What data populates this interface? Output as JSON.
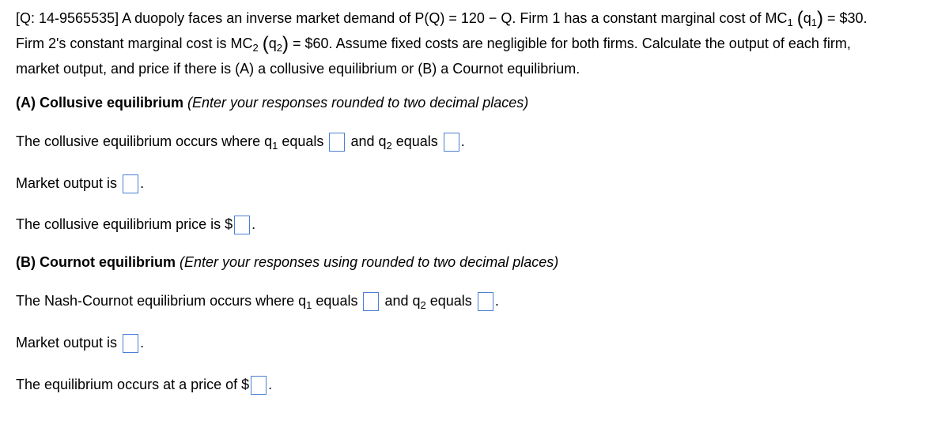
{
  "question": {
    "id_prefix": "[Q: 14-9565535]",
    "line1_a": " A duopoly faces an inverse market demand of P(Q) = 120 − Q.  Firm 1 has a constant marginal cost of MC",
    "line1_sub1": "1",
    "line1_paren_open": "(",
    "line1_q": "q",
    "line1_sub2": "1",
    "line1_paren_close": ")",
    "line1_end": " = $30.",
    "line2_a": "Firm 2's constant marginal cost is MC",
    "line2_sub1": "2",
    "line2_paren_open": "(",
    "line2_q": "q",
    "line2_sub2": "2",
    "line2_paren_close": ")",
    "line2_end": " = $60.  Assume fixed costs are negligible for both firms.  Calculate the output of each firm,",
    "line3": "market output, and price if there is (A) a collusive equilibrium or (B) a Cournot equilibrium."
  },
  "partA": {
    "heading_bold": "(A) Collusive equilibrium",
    "heading_italic": " (Enter your responses rounded to two decimal places)",
    "q_line_a": "The collusive equilibrium occurs where q",
    "q_line_sub1": "1",
    "q_line_b": " equals",
    "q_line_c": " and q",
    "q_line_sub2": "2",
    "q_line_d": " equals",
    "q_line_end": ".",
    "market_output_label": "Market output is",
    "market_output_end": ".",
    "price_label": "The collusive equilibrium price is $",
    "price_end": ".",
    "inputs": {
      "q1": "",
      "q2": "",
      "market_output": "",
      "price": ""
    }
  },
  "partB": {
    "heading_bold": "(B) Cournot equilibrium",
    "heading_italic": " (Enter your responses using rounded to two decimal places)",
    "q_line_a": "The Nash-Cournot equilibrium occurs where q",
    "q_line_sub1": "1",
    "q_line_b": " equals",
    "q_line_c": " and q",
    "q_line_sub2": "2",
    "q_line_d": " equals",
    "q_line_end": ".",
    "market_output_label": "Market output is",
    "market_output_end": ".",
    "price_label": "The equilibrium occurs at a price of $",
    "price_end": ".",
    "inputs": {
      "q1": "",
      "q2": "",
      "market_output": "",
      "price": ""
    }
  },
  "colors": {
    "input_border": "#4a7fd6",
    "text": "#000000"
  }
}
